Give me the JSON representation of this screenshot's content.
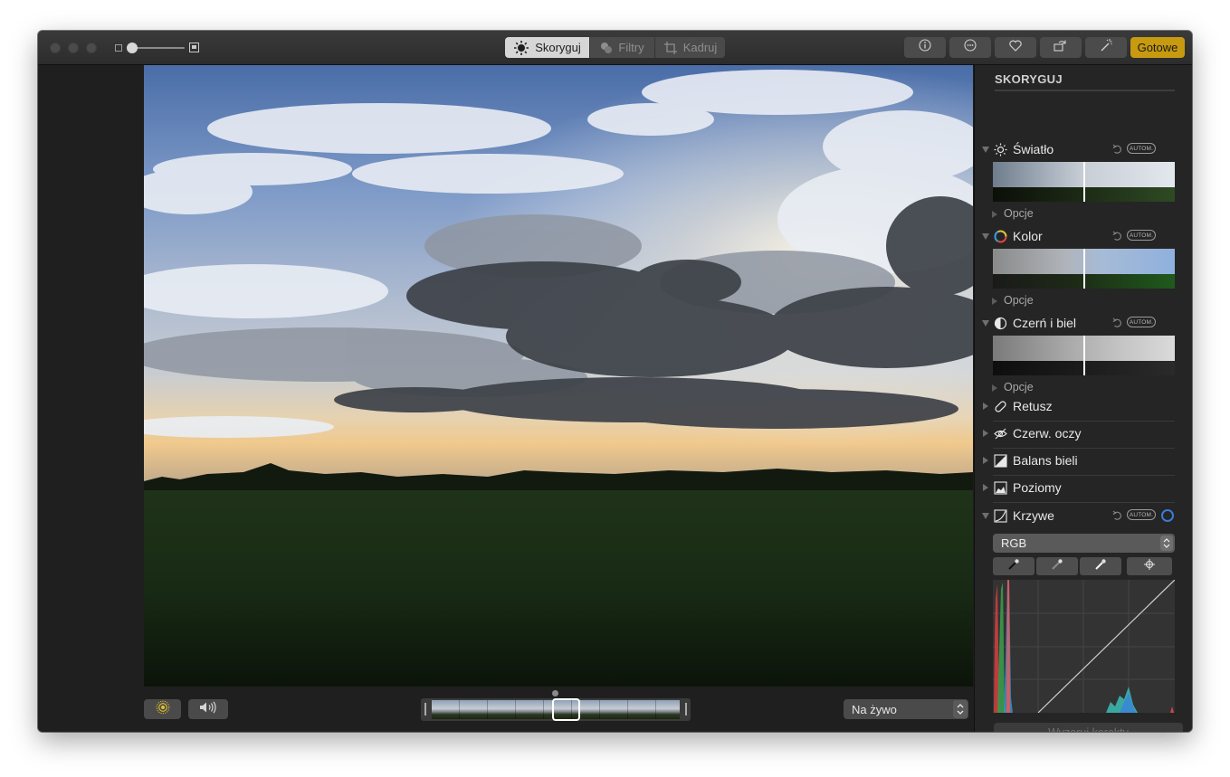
{
  "toolbar": {
    "tabs": [
      {
        "label": "Skoryguj",
        "icon": "adjust-sun-icon",
        "active": true
      },
      {
        "label": "Filtry",
        "icon": "filters-circles-icon",
        "active": false
      },
      {
        "label": "Kadruj",
        "icon": "crop-icon",
        "active": false
      }
    ],
    "right_buttons": [
      "info-icon",
      "more-dots-icon",
      "heart-icon",
      "rotate-icon",
      "magic-wand-icon"
    ],
    "done_label": "Gotowe",
    "accent_color": "#c79a0f"
  },
  "bottom": {
    "live_select_value": "Na żywo",
    "live_icon": "live-photo-icon",
    "sound_icon": "speaker-icon"
  },
  "sidebar": {
    "title": "SKORYGUJ",
    "auto_label": "AUTOM.",
    "options_label": "Opcje",
    "expanded": [
      {
        "label": "Światło",
        "icon": "sun-icon"
      },
      {
        "label": "Kolor",
        "icon": "color-wheel-icon"
      },
      {
        "label": "Czerń i biel",
        "icon": "half-circle-icon"
      }
    ],
    "collapsed": [
      {
        "label": "Retusz",
        "icon": "bandage-icon"
      },
      {
        "label": "Czerw. oczy",
        "icon": "eye-icon"
      },
      {
        "label": "Balans bieli",
        "icon": "white-balance-icon"
      },
      {
        "label": "Poziomy",
        "icon": "levels-icon"
      }
    ],
    "curves": {
      "label": "Krzywe",
      "icon": "curves-icon",
      "channel_value": "RGB",
      "tools": [
        "black-point-eyedropper-icon",
        "gray-point-eyedropper-icon",
        "white-point-eyedropper-icon",
        "add-point-crosshair-icon"
      ]
    },
    "reset_label": "Wyzeruj korekty"
  }
}
